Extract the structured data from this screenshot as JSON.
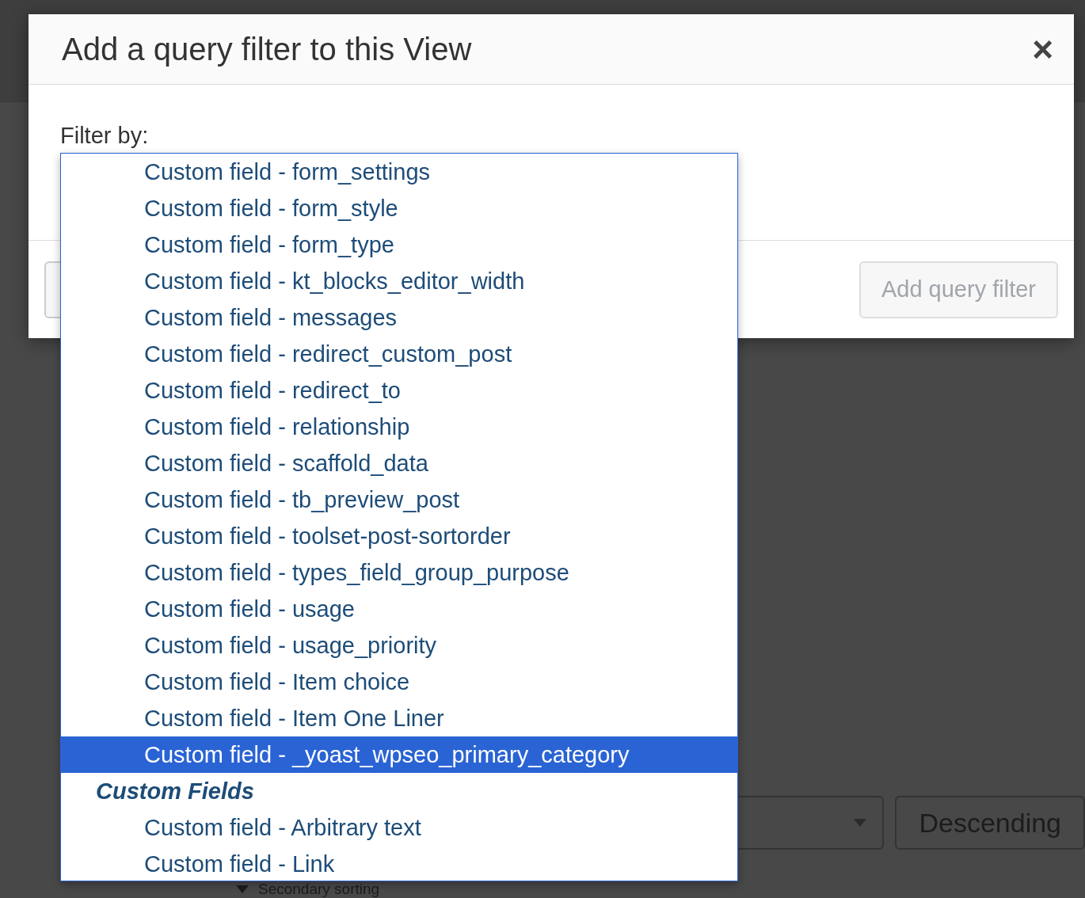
{
  "dialog": {
    "title": "Add a query filter to this View",
    "close": "×",
    "filter_label": "Filter by:",
    "add_button": {
      "label": "Add query filter",
      "disabled": true
    }
  },
  "filter_dropdown": {
    "options": [
      {
        "kind": "option",
        "label": "Custom field - form_settings",
        "selected": false
      },
      {
        "kind": "option",
        "label": "Custom field - form_style",
        "selected": false
      },
      {
        "kind": "option",
        "label": "Custom field - form_type",
        "selected": false
      },
      {
        "kind": "option",
        "label": "Custom field - kt_blocks_editor_width",
        "selected": false
      },
      {
        "kind": "option",
        "label": "Custom field - messages",
        "selected": false
      },
      {
        "kind": "option",
        "label": "Custom field - redirect_custom_post",
        "selected": false
      },
      {
        "kind": "option",
        "label": "Custom field - redirect_to",
        "selected": false
      },
      {
        "kind": "option",
        "label": "Custom field - relationship",
        "selected": false
      },
      {
        "kind": "option",
        "label": "Custom field - scaffold_data",
        "selected": false
      },
      {
        "kind": "option",
        "label": "Custom field - tb_preview_post",
        "selected": false
      },
      {
        "kind": "option",
        "label": "Custom field - toolset-post-sortorder",
        "selected": false
      },
      {
        "kind": "option",
        "label": "Custom field - types_field_group_purpose",
        "selected": false
      },
      {
        "kind": "option",
        "label": "Custom field - usage",
        "selected": false
      },
      {
        "kind": "option",
        "label": "Custom field - usage_priority",
        "selected": false
      },
      {
        "kind": "option",
        "label": "Custom field - Item choice",
        "selected": false
      },
      {
        "kind": "option",
        "label": "Custom field - Item One Liner",
        "selected": false
      },
      {
        "kind": "option",
        "label": "Custom field - _yoast_wpseo_primary_category",
        "selected": true
      },
      {
        "kind": "group",
        "label": "Custom Fields"
      },
      {
        "kind": "option",
        "label": "Custom field - Arbitrary text",
        "selected": false
      },
      {
        "kind": "option",
        "label": "Custom field - Link",
        "selected": false
      }
    ]
  },
  "background_page": {
    "order_select": "Descending",
    "secondary_sorting": "Secondary sorting"
  }
}
